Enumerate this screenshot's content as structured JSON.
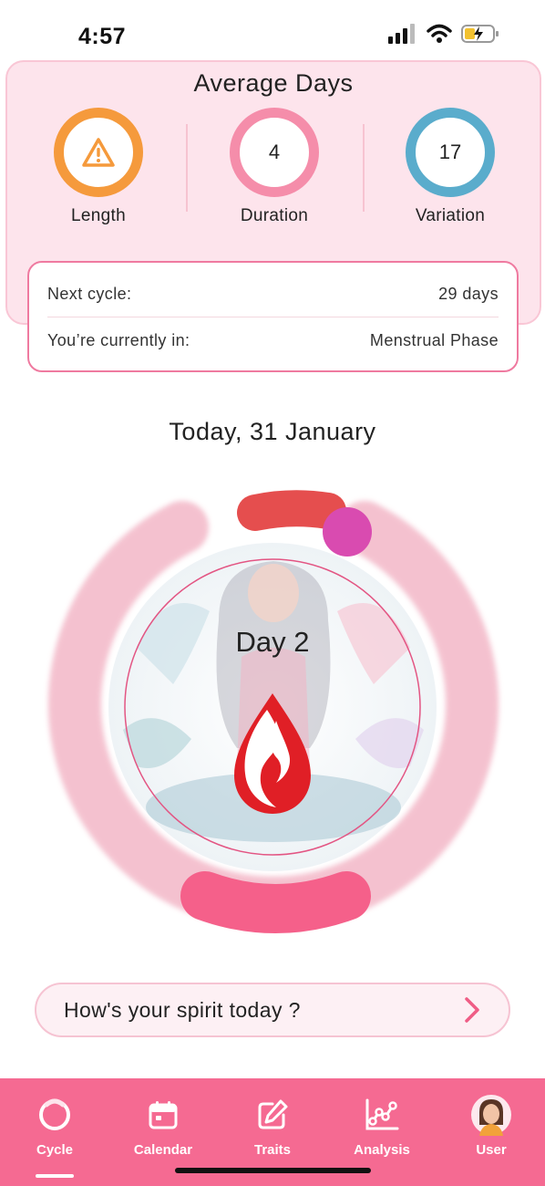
{
  "status_bar": {
    "time": "4:57"
  },
  "average": {
    "title": "Average Days",
    "stats": [
      {
        "label": "Length",
        "value": "",
        "icon": "warning-icon",
        "color": "#f59a3c"
      },
      {
        "label": "Duration",
        "value": "4",
        "color": "#f58daa"
      },
      {
        "label": "Variation",
        "value": "17",
        "color": "#5aaccc"
      }
    ]
  },
  "info": {
    "next_cycle_label": "Next cycle:",
    "next_cycle_value": "29 days",
    "current_phase_label": "You’re currently in:",
    "current_phase_value": "Menstrual Phase"
  },
  "today": "Today, 31 January",
  "cycle": {
    "day_label": "Day 2",
    "colors": {
      "ring": "#f3b7c7",
      "period": "#f5608a",
      "marker": "#d94bb0",
      "indicator": "#e23b3b"
    },
    "icon": "blood-drop-icon"
  },
  "spirit": {
    "prompt": "How's your spirit today ?",
    "icon": "chevron-right-icon"
  },
  "nav": {
    "items": [
      {
        "label": "Cycle",
        "icon": "cycle-icon",
        "active": true
      },
      {
        "label": "Calendar",
        "icon": "calendar-icon"
      },
      {
        "label": "Traits",
        "icon": "edit-icon"
      },
      {
        "label": "Analysis",
        "icon": "analysis-icon"
      },
      {
        "label": "User",
        "icon": "avatar"
      }
    ]
  },
  "colors": {
    "accent": "#f56a92",
    "card_bg": "#fde4ec"
  }
}
